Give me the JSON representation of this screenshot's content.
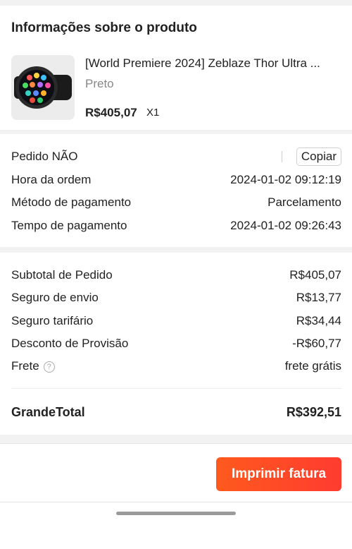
{
  "product_section": {
    "title": "Informações sobre o produto",
    "product": {
      "name": "[World Premiere 2024] Zeblaze Thor Ultra ...",
      "variant": "Preto",
      "price": "R$405,07",
      "quantity": "X1",
      "image_icon": "smartwatch-icon"
    }
  },
  "order_info": {
    "order_no_label": "Pedido NÃO",
    "copy_label": "Copiar",
    "order_time_label": "Hora da ordem",
    "order_time": "2024-01-02 09:12:19",
    "payment_method_label": "Método de pagamento",
    "payment_method": "Parcelamento",
    "payment_time_label": "Tempo de pagamento",
    "payment_time": "2024-01-02 09:26:43"
  },
  "summary": {
    "subtotal_label": "Subtotal de Pedido",
    "subtotal": "R$405,07",
    "shipping_insurance_label": "Seguro de envio",
    "shipping_insurance": "R$13,77",
    "tariff_insurance_label": "Seguro tarifário",
    "tariff_insurance": "R$34,44",
    "discount_label": "Desconto de Provisão",
    "discount": "-R$60,77",
    "freight_label": "Frete",
    "freight": "frete grátis",
    "grand_total_label": "GrandeTotal",
    "grand_total": "R$392,51"
  },
  "bottom": {
    "print_label": "Imprimir fatura",
    "accent_color": "#ff4a25"
  }
}
